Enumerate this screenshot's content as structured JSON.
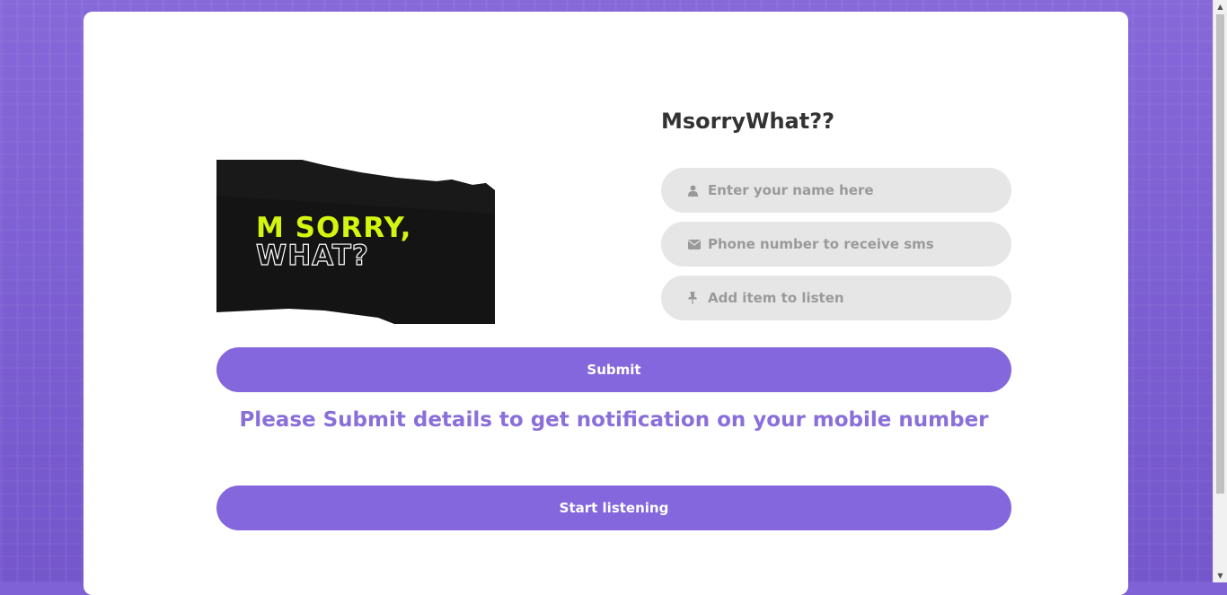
{
  "app": {
    "title": "MsorryWhat??"
  },
  "logo": {
    "line1": "M SORRY,",
    "line2": "WHAT?"
  },
  "form": {
    "name_placeholder": "Enter your name here",
    "phone_placeholder": "Phone number to receive sms",
    "item_placeholder": "Add item to listen",
    "name_value": "",
    "phone_value": "",
    "item_value": ""
  },
  "buttons": {
    "submit_label": "Submit",
    "listen_label": "Start listening"
  },
  "messages": {
    "notice": "Please Submit details to get notification on your mobile number"
  },
  "icons": {
    "name": "user-icon",
    "phone": "envelope-icon",
    "item": "pin-icon"
  },
  "colors": {
    "accent": "#8467dc",
    "notice": "#8a6fdb",
    "field_bg": "#e6e6e6",
    "logo_yellow": "#d4f50f"
  }
}
